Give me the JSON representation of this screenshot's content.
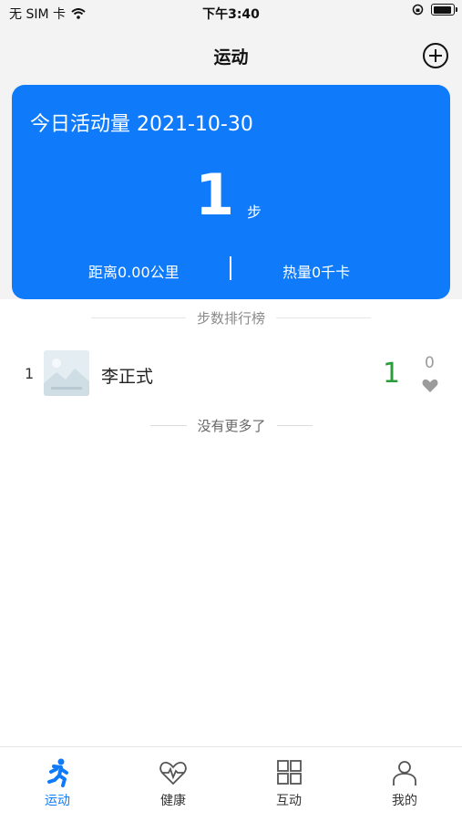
{
  "status_bar": {
    "carrier": "无 SIM 卡",
    "time": "下午3:40"
  },
  "nav": {
    "title": "运动"
  },
  "summary": {
    "title": "今日活动量 2021-10-30",
    "steps": "1",
    "steps_unit": "步",
    "distance": "距离0.00公里",
    "calories": "热量0千卡"
  },
  "ranking": {
    "title": "步数排行榜",
    "rows": [
      {
        "rank": "1",
        "name": "李正式",
        "steps": "1",
        "likes": "0"
      }
    ],
    "end_text": "没有更多了"
  },
  "tabs": [
    {
      "label": "运动",
      "icon": "running-icon",
      "active": true
    },
    {
      "label": "健康",
      "icon": "heart-pulse-icon",
      "active": false
    },
    {
      "label": "互动",
      "icon": "grid-icon",
      "active": false
    },
    {
      "label": "我的",
      "icon": "user-icon",
      "active": false
    }
  ],
  "colors": {
    "accent": "#0f7bfa",
    "steps_green": "#2a9d3a"
  }
}
